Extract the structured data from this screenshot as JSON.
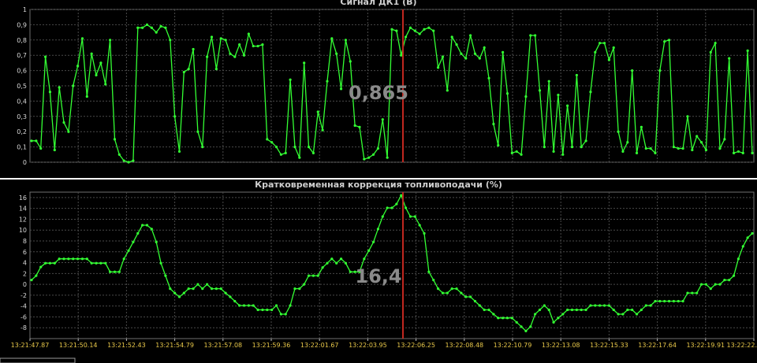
{
  "chart_data": [
    {
      "type": "line",
      "title": "Сигнал ДК1  (В)",
      "ylim": [
        0,
        1
      ],
      "yticks": [
        "0",
        "0,1",
        "0,2",
        "0,3",
        "0,4",
        "0,5",
        "0,6",
        "0,7",
        "0,8",
        "0,9",
        "1"
      ],
      "grid": true,
      "color": "#33ff33",
      "cursor_value": "0,865",
      "series": [
        {
          "values": [
            0.14,
            0.14,
            0.09,
            0.69,
            0.46,
            0.08,
            0.49,
            0.26,
            0.2,
            0.5,
            0.63,
            0.81,
            0.43,
            0.71,
            0.57,
            0.65,
            0.51,
            0.8,
            0.15,
            0.05,
            0.01,
            0.0,
            0.01,
            0.88,
            0.88,
            0.9,
            0.88,
            0.85,
            0.89,
            0.88,
            0.8,
            0.3,
            0.07,
            0.59,
            0.61,
            0.74,
            0.2,
            0.1,
            0.69,
            0.82,
            0.61,
            0.81,
            0.8,
            0.71,
            0.69,
            0.77,
            0.7,
            0.84,
            0.76,
            0.76,
            0.77,
            0.15,
            0.13,
            0.1,
            0.05,
            0.06,
            0.54,
            0.1,
            0.03,
            0.65,
            0.1,
            0.06,
            0.33,
            0.21,
            0.53,
            0.81,
            0.71,
            0.48,
            0.8,
            0.66,
            0.24,
            0.23,
            0.02,
            0.03,
            0.05,
            0.09,
            0.28,
            0.03,
            0.87,
            0.86,
            0.7,
            0.82,
            0.88,
            0.86,
            0.84,
            0.87,
            0.88,
            0.86,
            0.62,
            0.69,
            0.47,
            0.82,
            0.77,
            0.71,
            0.68,
            0.83,
            0.71,
            0.68,
            0.75,
            0.55,
            0.25,
            0.11,
            0.72,
            0.45,
            0.06,
            0.07,
            0.05,
            0.43,
            0.83,
            0.83,
            0.47,
            0.1,
            0.53,
            0.07,
            0.44,
            0.05,
            0.37,
            0.1,
            0.57,
            0.1,
            0.14,
            0.46,
            0.72,
            0.78,
            0.78,
            0.67,
            0.75,
            0.2,
            0.07,
            0.13,
            0.6,
            0.06,
            0.23,
            0.09,
            0.09,
            0.06,
            0.6,
            0.79,
            0.8,
            0.1,
            0.09,
            0.09,
            0.3,
            0.08,
            0.17,
            0.13,
            0.08,
            0.72,
            0.78,
            0.09,
            0.15,
            0.68,
            0.06,
            0.07,
            0.06,
            0.73,
            0.06
          ]
        }
      ]
    },
    {
      "type": "line",
      "title": "Кратковременная коррекция топливоподачи  (%)",
      "ylim": [
        -10,
        17
      ],
      "yticks": [
        "-8",
        "-6",
        "-4",
        "-2",
        "0",
        "2",
        "4",
        "6",
        "8",
        "10",
        "12",
        "14",
        "16"
      ],
      "ytick_values": [
        -8,
        -6,
        -4,
        -2,
        0,
        2,
        4,
        6,
        8,
        10,
        12,
        14,
        16
      ],
      "grid": true,
      "color": "#33ff33",
      "cursor_value": "16,4",
      "x_tick_labels": [
        "13:21:47.87",
        "13:21:50.14",
        "13:21:52.43",
        "13:21:54.79",
        "13:21:57.08",
        "13:21:59.36",
        "13:22:01.67",
        "13:22:03.95",
        "13:22:06.25",
        "13:22:08.48",
        "13:22:10.79",
        "13:22:13.08",
        "13:22:15.33",
        "13:22:17.64",
        "13:22:19.91",
        "13:22:22."
      ],
      "series": [
        {
          "values": [
            0.8,
            1.6,
            3.2,
            3.9,
            3.9,
            3.9,
            4.7,
            4.7,
            4.7,
            4.7,
            4.7,
            4.7,
            4.7,
            3.9,
            3.9,
            3.9,
            3.9,
            2.3,
            2.3,
            2.3,
            4.7,
            6.2,
            7.8,
            9.4,
            10.9,
            10.9,
            10.2,
            7.8,
            3.9,
            1.6,
            -0.8,
            -1.6,
            -2.3,
            -1.6,
            -0.8,
            -0.8,
            0.0,
            -0.8,
            0.0,
            -0.8,
            -0.8,
            -0.8,
            -1.6,
            -2.3,
            -3.1,
            -3.9,
            -3.9,
            -3.9,
            -3.9,
            -4.7,
            -4.7,
            -4.7,
            -4.7,
            -3.9,
            -5.5,
            -5.5,
            -3.9,
            -0.8,
            -0.8,
            0.0,
            1.6,
            1.6,
            1.6,
            3.1,
            3.9,
            4.7,
            3.9,
            4.7,
            3.9,
            2.3,
            2.3,
            2.3,
            4.7,
            6.2,
            7.8,
            10.2,
            12.5,
            14.1,
            14.1,
            14.8,
            16.4,
            14.1,
            12.5,
            12.5,
            10.9,
            9.4,
            2.3,
            0.8,
            -0.8,
            -1.6,
            -1.6,
            -0.8,
            -0.8,
            -1.6,
            -2.3,
            -2.3,
            -3.1,
            -3.9,
            -4.7,
            -4.7,
            -5.5,
            -6.2,
            -6.2,
            -6.2,
            -6.2,
            -7.0,
            -7.8,
            -8.6,
            -7.8,
            -5.5,
            -4.7,
            -3.9,
            -4.7,
            -7.0,
            -6.2,
            -5.5,
            -4.7,
            -4.7,
            -4.7,
            -4.7,
            -4.7,
            -3.9,
            -3.9,
            -3.9,
            -3.9,
            -3.9,
            -4.7,
            -5.5,
            -5.5,
            -4.7,
            -4.7,
            -5.5,
            -4.7,
            -3.9,
            -3.9,
            -3.1,
            -3.1,
            -3.1,
            -3.1,
            -3.1,
            -3.1,
            -3.1,
            -1.6,
            -1.6,
            -1.6,
            0.0,
            0.0,
            -0.8,
            0.0,
            0.0,
            0.8,
            0.8,
            1.6,
            4.7,
            7.0,
            8.6,
            9.4
          ]
        }
      ]
    }
  ]
}
